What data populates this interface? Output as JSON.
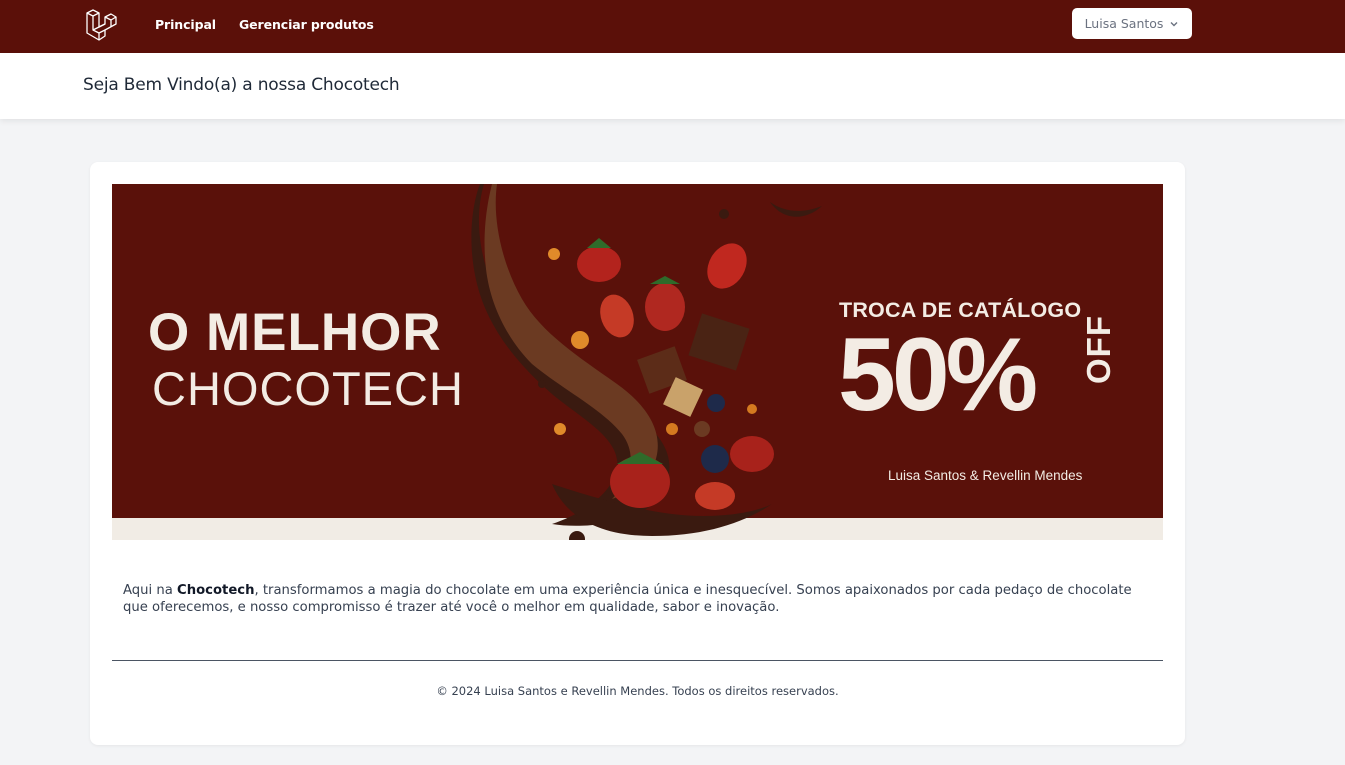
{
  "nav": {
    "links": [
      "Principal",
      "Gerenciar produtos"
    ],
    "user_name": "Luisa Santos"
  },
  "header": {
    "title": "Seja Bem Vindo(a) a nossa Chocotech"
  },
  "banner": {
    "headline_1": "O MELHOR",
    "headline_2": "CHOCOTECH",
    "promo_title": "TROCA DE CATÁLOGO",
    "promo_value": "50%",
    "promo_off": "OFF",
    "credits": "Luisa Santos & Revellin Mendes"
  },
  "about": {
    "prefix": "Aqui na ",
    "brand": "Chocotech",
    "text": ", transformamos a magia do chocolate em uma experiência única e inesquecível. Somos apaixonados por cada pedaço de chocolate que oferecemos, e nosso compromisso é trazer até você o melhor em qualidade, sabor e inovação."
  },
  "footer": {
    "copyright": "© 2024 Luisa Santos e Revellin Mendes. Todos os direitos reservados."
  },
  "colors": {
    "brand": "#5b1009",
    "banner_bg": "#5a110a",
    "cream": "#f3ece4"
  }
}
